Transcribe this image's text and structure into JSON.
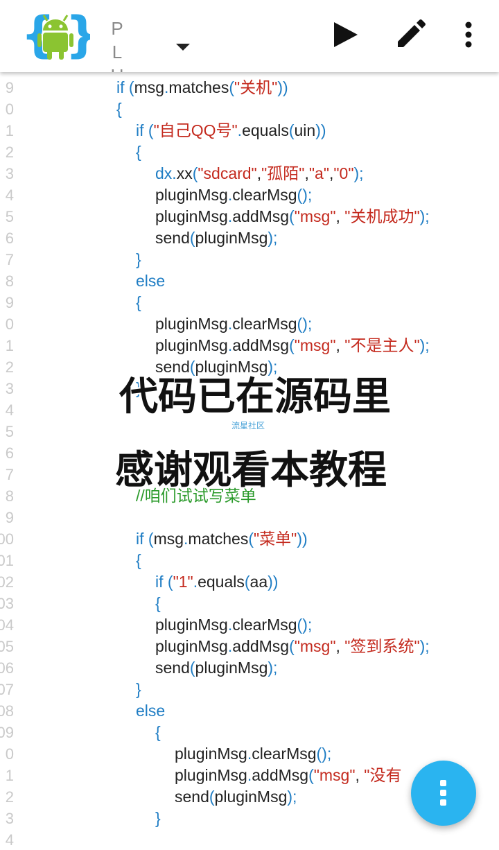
{
  "toolbar": {
    "title_chars": [
      "P",
      "L",
      "U"
    ],
    "run_icon": "play-icon",
    "edit_icon": "pencil-icon",
    "more_icon": "more-vert-icon",
    "dropdown_icon": "caret-down-icon",
    "logo_icon": "android-brackets-icon"
  },
  "editor": {
    "line_numbers": [
      "9",
      "0",
      "1",
      "2",
      "3",
      "4",
      "5",
      "6",
      "7",
      "8",
      "9",
      "0",
      "1",
      "2",
      "3",
      "4",
      "5",
      "6",
      "7",
      "8",
      "9",
      "00",
      "01",
      "02",
      "03",
      "04",
      "05",
      "06",
      "07",
      "08",
      "09",
      "0",
      "1",
      "2",
      "3",
      "4"
    ],
    "lines": [
      [
        {
          "t": "if ",
          "c": "kw"
        },
        {
          "t": "(",
          "c": "pn"
        },
        {
          "t": "msg",
          "c": "fn"
        },
        {
          "t": ".",
          "c": "pn"
        },
        {
          "t": "matches",
          "c": "fn"
        },
        {
          "t": "(",
          "c": "pn"
        },
        {
          "t": "\"关机\"",
          "c": "str"
        },
        {
          "t": "))",
          "c": "pn"
        }
      ],
      [
        {
          "t": "{",
          "c": "pn"
        }
      ],
      [
        {
          "t": "if ",
          "c": "kw"
        },
        {
          "t": "(",
          "c": "pn"
        },
        {
          "t": "\"自己QQ号\"",
          "c": "str"
        },
        {
          "t": ".",
          "c": "pn"
        },
        {
          "t": "equals",
          "c": "fn"
        },
        {
          "t": "(",
          "c": "pn"
        },
        {
          "t": "uin",
          "c": "fn"
        },
        {
          "t": "))",
          "c": "pn"
        }
      ],
      [
        {
          "t": "{",
          "c": "pn"
        }
      ],
      [
        {
          "t": "dx",
          "c": "kw"
        },
        {
          "t": ".",
          "c": "pn"
        },
        {
          "t": "xx",
          "c": "fn"
        },
        {
          "t": "(",
          "c": "pn"
        },
        {
          "t": "\"sdcard\"",
          "c": "str"
        },
        {
          "t": ",",
          "c": "fn"
        },
        {
          "t": "\"孤陌\"",
          "c": "str"
        },
        {
          "t": ",",
          "c": "fn"
        },
        {
          "t": "\"a\"",
          "c": "str"
        },
        {
          "t": ",",
          "c": "fn"
        },
        {
          "t": "\"0\"",
          "c": "str"
        },
        {
          "t": ");",
          "c": "pn"
        }
      ],
      [
        {
          "t": "pluginMsg",
          "c": "fn"
        },
        {
          "t": ".",
          "c": "pn"
        },
        {
          "t": "clearMsg",
          "c": "fn"
        },
        {
          "t": "();",
          "c": "pn"
        }
      ],
      [
        {
          "t": "pluginMsg",
          "c": "fn"
        },
        {
          "t": ".",
          "c": "pn"
        },
        {
          "t": "addMsg",
          "c": "fn"
        },
        {
          "t": "(",
          "c": "pn"
        },
        {
          "t": "\"msg\"",
          "c": "str"
        },
        {
          "t": ", ",
          "c": "fn"
        },
        {
          "t": "\"关机成功\"",
          "c": "str"
        },
        {
          "t": ");",
          "c": "pn"
        }
      ],
      [
        {
          "t": "send",
          "c": "fn"
        },
        {
          "t": "(",
          "c": "pn"
        },
        {
          "t": "pluginMsg",
          "c": "fn"
        },
        {
          "t": ");",
          "c": "pn"
        }
      ],
      [
        {
          "t": "}",
          "c": "pn"
        }
      ],
      [
        {
          "t": "else",
          "c": "kw"
        }
      ],
      [
        {
          "t": "{",
          "c": "pn"
        }
      ],
      [
        {
          "t": "pluginMsg",
          "c": "fn"
        },
        {
          "t": ".",
          "c": "pn"
        },
        {
          "t": "clearMsg",
          "c": "fn"
        },
        {
          "t": "();",
          "c": "pn"
        }
      ],
      [
        {
          "t": "pluginMsg",
          "c": "fn"
        },
        {
          "t": ".",
          "c": "pn"
        },
        {
          "t": "addMsg",
          "c": "fn"
        },
        {
          "t": "(",
          "c": "pn"
        },
        {
          "t": "\"msg\"",
          "c": "str"
        },
        {
          "t": ", ",
          "c": "fn"
        },
        {
          "t": "\"不是主人\"",
          "c": "str"
        },
        {
          "t": ");",
          "c": "pn"
        }
      ],
      [
        {
          "t": "send",
          "c": "fn"
        },
        {
          "t": "(",
          "c": "pn"
        },
        {
          "t": "pluginMsg",
          "c": "fn"
        },
        {
          "t": ");",
          "c": "pn"
        }
      ],
      [
        {
          "t": "}",
          "c": "pn"
        }
      ],
      [],
      [],
      [],
      [],
      [
        {
          "t": "//咱们试试写菜单",
          "c": "cm"
        }
      ],
      [],
      [
        {
          "t": "if ",
          "c": "kw"
        },
        {
          "t": "(",
          "c": "pn"
        },
        {
          "t": "msg",
          "c": "fn"
        },
        {
          "t": ".",
          "c": "pn"
        },
        {
          "t": "matches",
          "c": "fn"
        },
        {
          "t": "(",
          "c": "pn"
        },
        {
          "t": "\"菜单\"",
          "c": "str"
        },
        {
          "t": "))",
          "c": "pn"
        }
      ],
      [
        {
          "t": "{",
          "c": "pn"
        }
      ],
      [
        {
          "t": "if ",
          "c": "kw"
        },
        {
          "t": "(",
          "c": "pn"
        },
        {
          "t": "\"1\"",
          "c": "str"
        },
        {
          "t": ".",
          "c": "pn"
        },
        {
          "t": "equals",
          "c": "fn"
        },
        {
          "t": "(",
          "c": "pn"
        },
        {
          "t": "aa",
          "c": "fn"
        },
        {
          "t": "))",
          "c": "pn"
        }
      ],
      [
        {
          "t": "{",
          "c": "pn"
        }
      ],
      [
        {
          "t": "pluginMsg",
          "c": "fn"
        },
        {
          "t": ".",
          "c": "pn"
        },
        {
          "t": "clearMsg",
          "c": "fn"
        },
        {
          "t": "();",
          "c": "pn"
        }
      ],
      [
        {
          "t": "pluginMsg",
          "c": "fn"
        },
        {
          "t": ".",
          "c": "pn"
        },
        {
          "t": "addMsg",
          "c": "fn"
        },
        {
          "t": "(",
          "c": "pn"
        },
        {
          "t": "\"msg\"",
          "c": "str"
        },
        {
          "t": ", ",
          "c": "fn"
        },
        {
          "t": "\"签到系统\"",
          "c": "str"
        },
        {
          "t": ");",
          "c": "pn"
        }
      ],
      [
        {
          "t": "send",
          "c": "fn"
        },
        {
          "t": "(",
          "c": "pn"
        },
        {
          "t": "pluginMsg",
          "c": "fn"
        },
        {
          "t": ");",
          "c": "pn"
        }
      ],
      [
        {
          "t": "}",
          "c": "pn"
        }
      ],
      [
        {
          "t": "else",
          "c": "kw"
        }
      ],
      [
        {
          "t": "{",
          "c": "pn"
        }
      ],
      [
        {
          "t": "pluginMsg",
          "c": "fn"
        },
        {
          "t": ".",
          "c": "pn"
        },
        {
          "t": "clearMsg",
          "c": "fn"
        },
        {
          "t": "();",
          "c": "pn"
        }
      ],
      [
        {
          "t": "pluginMsg",
          "c": "fn"
        },
        {
          "t": ".",
          "c": "pn"
        },
        {
          "t": "addMsg",
          "c": "fn"
        },
        {
          "t": "(",
          "c": "pn"
        },
        {
          "t": "\"msg\"",
          "c": "str"
        },
        {
          "t": ", ",
          "c": "fn"
        },
        {
          "t": "\"没有",
          "c": "str"
        }
      ],
      [
        {
          "t": "send",
          "c": "fn"
        },
        {
          "t": "(",
          "c": "pn"
        },
        {
          "t": "pluginMsg",
          "c": "fn"
        },
        {
          "t": ");",
          "c": "pn"
        }
      ],
      [
        {
          "t": "}",
          "c": "pn"
        }
      ],
      []
    ]
  },
  "overlay": {
    "caption_1": "代码已在源码里",
    "caption_2": "感谢观看本教程",
    "watermark": "流星社区"
  },
  "fab": {
    "icon": "more-vert-icon"
  },
  "colors": {
    "keyword": "#1f7dc4",
    "string": "#c42a1e",
    "comment": "#2a9a2a",
    "fab": "#2ab4f0"
  }
}
